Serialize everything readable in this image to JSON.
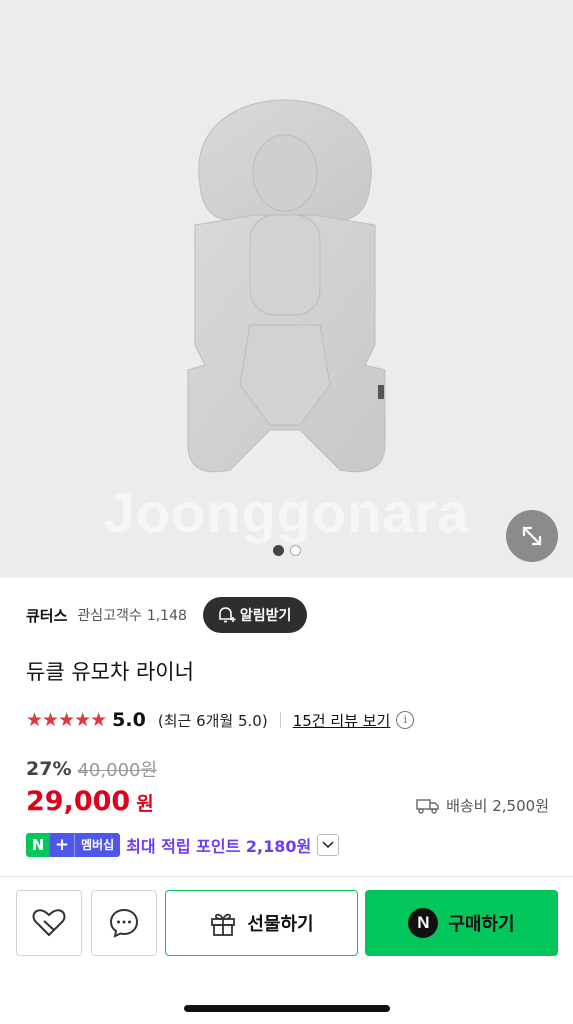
{
  "hero": {
    "watermark": "Joonggonara",
    "slide_count": 2,
    "active_slide": 1
  },
  "store": {
    "name": "큐터스",
    "followers_label": "관심고객수",
    "followers_count": "1,148",
    "alarm_label": "알림받기"
  },
  "product": {
    "title": "듀클 유모차 라이너"
  },
  "rating": {
    "stars": "★★★★★",
    "score": "5.0",
    "recent": "(최근 6개월 5.0)",
    "reviews_link": "15건 리뷰 보기",
    "info_symbol": "i"
  },
  "price": {
    "discount": "27%",
    "original": "40,000원",
    "current": "29,000",
    "currency": "원",
    "shipping": "배송비 2,500원"
  },
  "points": {
    "n_badge": "N",
    "plus_badge": "+",
    "membership": "멤버십",
    "text": "최대 적립 포인트 2,180원"
  },
  "actions": {
    "gift_label": "선물하기",
    "buy_logo": "N",
    "buy_label": "구매하기"
  },
  "colors": {
    "price_red": "#e0001c",
    "naver_green": "#03c75a",
    "points_purple": "#6b3df5",
    "star_red": "#e5363b"
  }
}
